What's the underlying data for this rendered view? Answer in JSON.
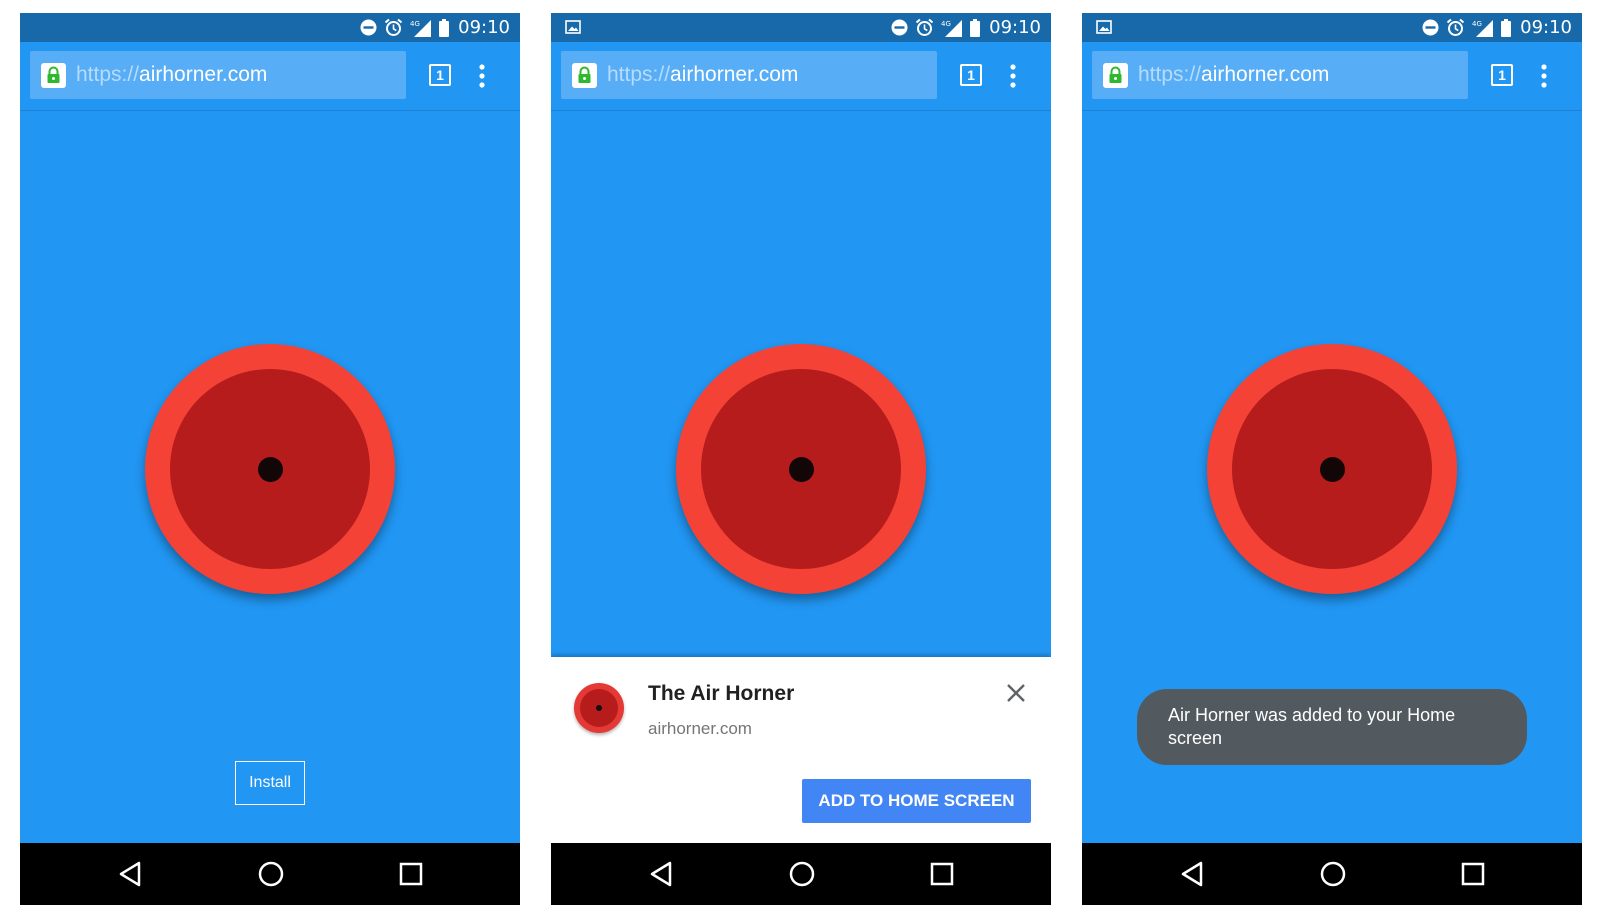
{
  "status_bar": {
    "time": "09:10",
    "network_label": "4G"
  },
  "browser": {
    "url_scheme": "https://",
    "url_host": "airhorner.com",
    "tab_count": "1"
  },
  "page": {
    "install_label": "Install"
  },
  "install_banner": {
    "app_name": "The Air Horner",
    "app_url": "airhorner.com",
    "add_button_label": "ADD TO HOME SCREEN"
  },
  "toast": {
    "message": "Air Horner was added to your Home screen"
  },
  "colors": {
    "page_background": "#2196f3",
    "status_bar": "#1769aa",
    "horn_outer": "#f44336",
    "horn_inner": "#b71c1c",
    "accent_button": "#4285f4",
    "toast_background": "#525a5f",
    "lock_green": "#2eb82e"
  },
  "icons": [
    "dnd-icon",
    "alarm-icon",
    "signal-icon",
    "battery-icon",
    "image-notification-icon",
    "lock-icon",
    "more-vert-icon",
    "close-icon",
    "nav-back-icon",
    "nav-home-icon",
    "nav-recents-icon"
  ]
}
